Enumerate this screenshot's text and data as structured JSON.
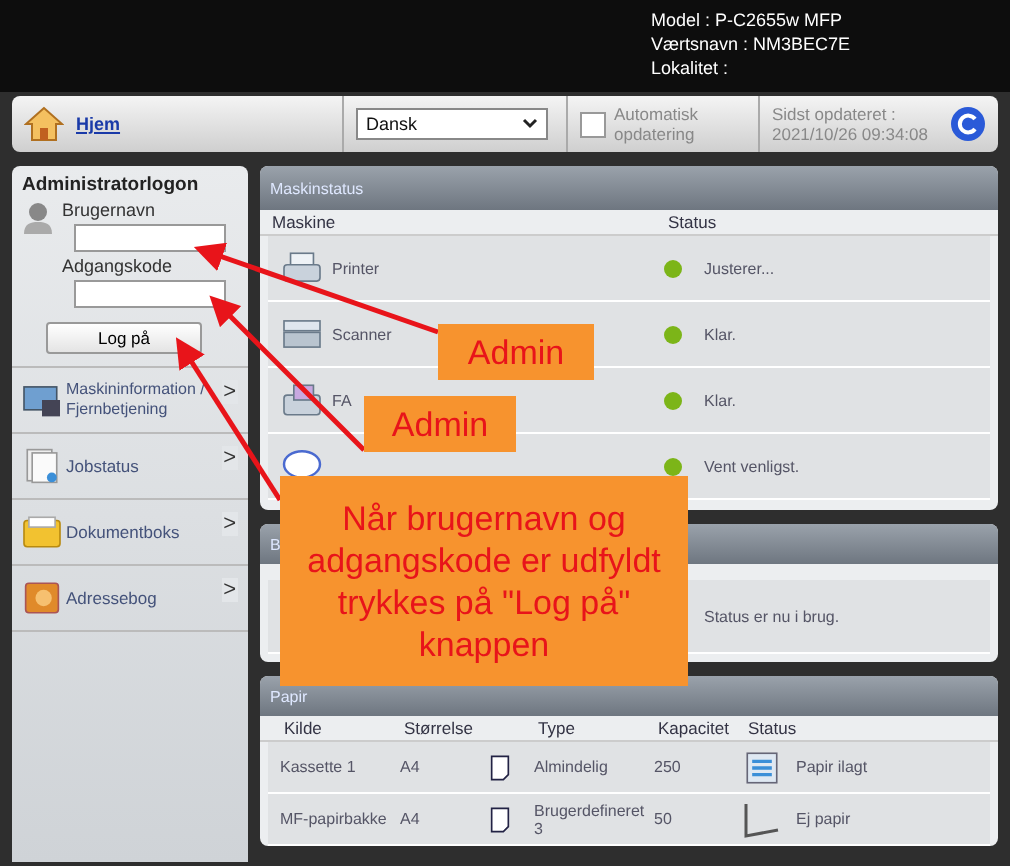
{
  "header": {
    "lines": [
      "Model : P-C2655w MFP",
      "Værtsnavn : NM3BEC7E",
      "Lokalitet :"
    ]
  },
  "toolbar": {
    "home": "Hjem",
    "language": "Dansk",
    "auto_update": {
      "label_lines": [
        "Automatisk",
        "opdatering"
      ],
      "checked": false
    },
    "updated_lines": [
      "Sidst opdateret :",
      "2021/10/26 09:34:08"
    ]
  },
  "login": {
    "title": "Administratorlogon",
    "username_label": "Brugernavn",
    "password_label": "Adgangskode",
    "button": "Log på"
  },
  "menu": [
    {
      "kind": "machine",
      "lines": [
        "Maskininformation /",
        "Fjernbetjening"
      ],
      "chevron": ">"
    },
    {
      "kind": "jobs",
      "lines": [
        "Jobstatus"
      ],
      "chevron": ">"
    },
    {
      "kind": "box",
      "lines": [
        "Dokumentboks"
      ],
      "chevron": ">"
    },
    {
      "kind": "address",
      "lines": [
        "Adressebog"
      ],
      "chevron": ">"
    }
  ],
  "machine_status": {
    "title": "Maskinstatus",
    "columns": [
      "Maskine",
      "Status"
    ],
    "rows": [
      {
        "kind": "printer",
        "name": "Printer",
        "color": "#7cb518",
        "status": "Justerer..."
      },
      {
        "kind": "scanner",
        "name": "Scanner",
        "color": "#7cb518",
        "status": "Klar."
      },
      {
        "kind": "fax",
        "name": "FA",
        "color": "#7cb518",
        "status": "Klar."
      },
      {
        "kind": "status",
        "color": "#7cb518",
        "status": "Vent venligst."
      }
    ]
  },
  "second_panel": {
    "title": "B",
    "status": "Status er nu i brug."
  },
  "paper": {
    "title": "Papir",
    "columns": [
      "Kilde",
      "Størrelse",
      "Type",
      "Kapacitet",
      "Status"
    ],
    "rows": [
      {
        "source": "Kassette 1",
        "size": "A4",
        "type": "Almindelig",
        "capacity": "250",
        "kind": "loaded",
        "status": "Papir ilagt"
      },
      {
        "source": "MF-papirbakke",
        "size": "A4",
        "type": "Brugerdefineret 3",
        "capacity": "50",
        "kind": "empty",
        "status": "Ej papir"
      }
    ]
  },
  "annotations": [
    {
      "text": "Admin"
    },
    {
      "text": "Admin"
    },
    {
      "text": "Når brugernavn og adgangskode er udfyldt trykkes på \"Log på\" knappen"
    }
  ]
}
